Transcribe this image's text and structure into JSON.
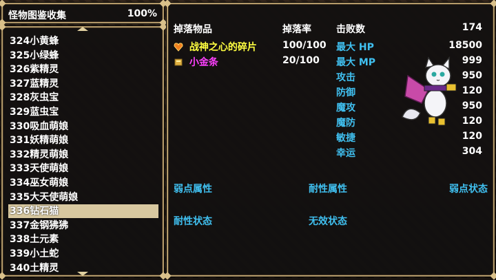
{
  "title": {
    "name": "怪物图鉴收集",
    "percent": "100%"
  },
  "monsters": [
    "324小黄蜂",
    "325小绿蜂",
    "326紫精灵",
    "327蓝精灵",
    "328灰虫宝",
    "329蓝虫宝",
    "330吸血萌娘",
    "331妖精萌娘",
    "332精灵萌娘",
    "333天使萌娘",
    "334巫女萌娘",
    "335大天使萌娘",
    "336钻石猫",
    "337金钢狒狒",
    "338土元素",
    "339小土蛇",
    "340土精灵"
  ],
  "selected_index": 12,
  "headers": {
    "drops": "掉落物品",
    "rate": "掉落率",
    "defeats": "击败数",
    "defeats_value": "174"
  },
  "drops": [
    {
      "name": "战神之心的碎片",
      "rate": "100/100",
      "color": "#ffff40",
      "icon": "heart-shard-icon"
    },
    {
      "name": "小金条",
      "rate": "20/100",
      "color": "#ff40ff",
      "icon": "gold-bar-icon"
    }
  ],
  "stats": [
    {
      "label": "最大 HP",
      "value": "18500"
    },
    {
      "label": "最大 MP",
      "value": "999"
    },
    {
      "label": "攻击",
      "value": "950"
    },
    {
      "label": "防御",
      "value": "120"
    },
    {
      "label": "魔攻",
      "value": "950"
    },
    {
      "label": "魔防",
      "value": "120"
    },
    {
      "label": "敏捷",
      "value": "120"
    },
    {
      "label": "幸运",
      "value": "304"
    }
  ],
  "sections": {
    "weak_attr": "弱点属性",
    "resist_attr": "耐性属性",
    "weak_state": "弱点状态",
    "resist_state": "耐性状态",
    "immune_state": "无效状态"
  },
  "colors": {
    "accent": "#40c0f0",
    "frame": "#b49a6a",
    "selected": "#d8c8a0"
  }
}
